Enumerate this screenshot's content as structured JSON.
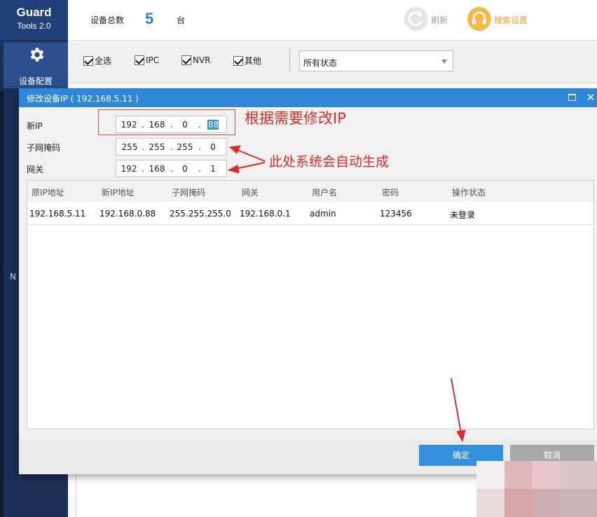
{
  "app": {
    "logo_main": "Guard",
    "logo_sub": "Tools 2.0",
    "nav_label": "设备配置",
    "sidebar_stub": "N"
  },
  "header": {
    "count_label": "设备总数",
    "count_value": "5",
    "count_unit": "台",
    "refresh_label": "刷新",
    "search_settings_label": "搜索设置"
  },
  "filters": {
    "select_all": "全选",
    "ipc": "IPC",
    "nvr": "NVR",
    "other": "其他",
    "status_value": "所有状态"
  },
  "dialog": {
    "title": "修改设备IP ( 192.168.5.11 )",
    "new_ip_label": "新IP",
    "subnet_label": "子网掩码",
    "gateway_label": "网关",
    "new_ip": [
      "192",
      "168",
      "0",
      "88"
    ],
    "subnet": [
      "255",
      "255",
      "255",
      "0"
    ],
    "gateway": [
      "192",
      "168",
      "0",
      "1"
    ],
    "annotation_top": "根据需要修改IP",
    "annotation_mid": "此处系统会自动生成",
    "table": {
      "headers": [
        "原IP地址",
        "新IP地址",
        "子网掩码",
        "网关",
        "用户名",
        "密码",
        "操作状态"
      ],
      "rows": [
        [
          "192.168.5.11",
          "192.168.0.88",
          "255.255.255.0",
          "192.168.0.1",
          "admin",
          "123456",
          "未登录"
        ]
      ]
    },
    "ok_label": "确定",
    "cancel_label": "取消"
  },
  "colors": {
    "brand_blue": "#2f87d8",
    "sidebar": "#1a2f55",
    "annotation_red": "#e02a2a",
    "search_orange": "#f6b947"
  }
}
